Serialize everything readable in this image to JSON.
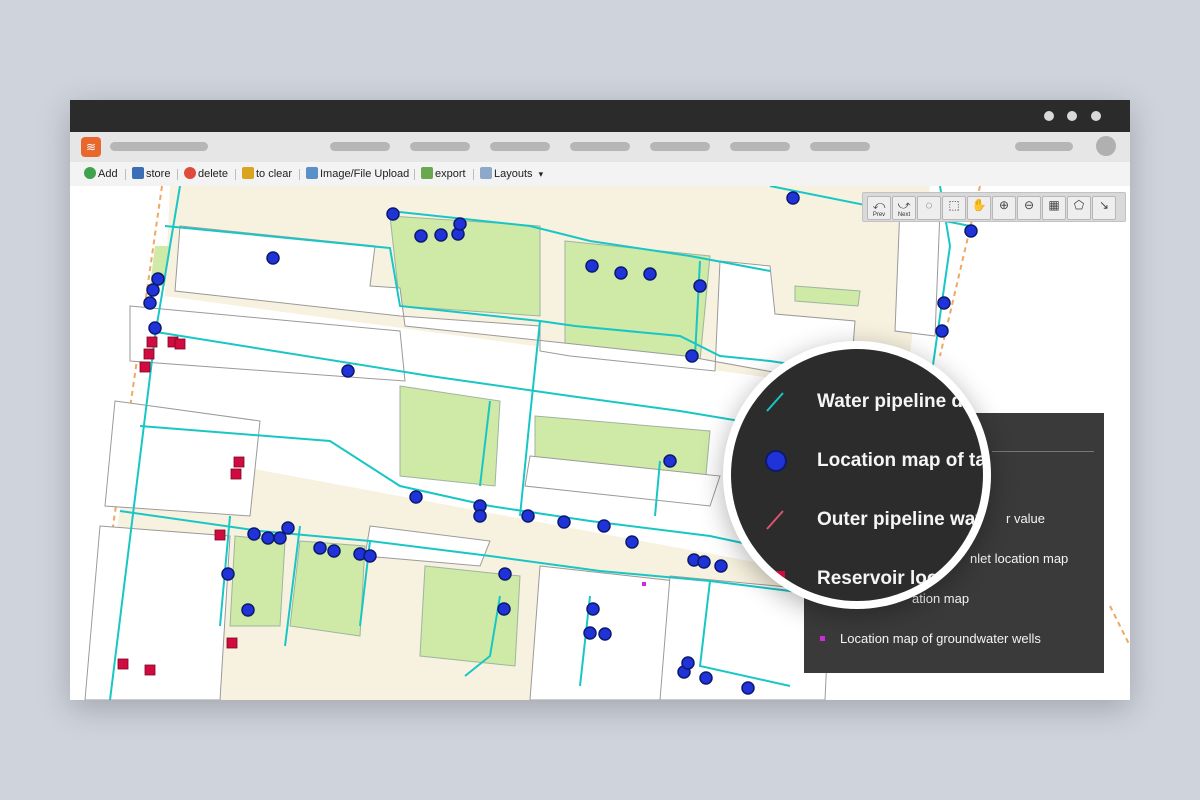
{
  "toolbar": {
    "add": "Add",
    "store": "store",
    "delete": "delete",
    "clear": "to clear",
    "upload": "Image/File Upload",
    "export": "export",
    "layouts": "Layouts",
    "layouts_caret": "▾"
  },
  "map_tools": {
    "prev": "Prev",
    "next": "Next"
  },
  "legend": {
    "items": [
      "r value",
      "nlet location map",
      "ation map",
      "Location map of groundwater wells"
    ]
  },
  "magnifier": {
    "items": [
      "Water pipeline d",
      "Location map of ta",
      "Outer pipeline wat",
      "Reservoir locat"
    ]
  },
  "colors": {
    "water_pipeline": "#19c6c6",
    "tap_location": "#1f33d9",
    "outer_pipeline": "#d9556e",
    "reservoir": "#d10b3f",
    "groundwater_well": "#d02bd8",
    "green_area": "#cfe9a6",
    "building_fill": "#ffffff",
    "road_orange": "#f0a860"
  }
}
